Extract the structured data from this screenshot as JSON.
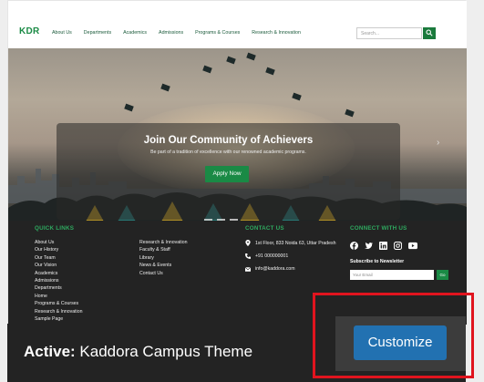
{
  "header": {
    "logo_text": "KDR",
    "nav_items": [
      "About Us",
      "Departments",
      "Academics",
      "Admissions",
      "Programs & Courses",
      "Research & Innovation"
    ],
    "search_placeholder": "Search..."
  },
  "hero": {
    "title": "Join Our Community of Achievers",
    "subtitle": "Be part of a tradition of excellence with our renowned academic programs.",
    "cta_label": "Apply Now"
  },
  "footer": {
    "quick_links_title": "QUICK LINKS",
    "quick_links_col1": [
      "About Us",
      "Our History",
      "Our Team",
      "Our Vision",
      "Academics",
      "Admissions",
      "Departments",
      "Home",
      "Programs & Courses",
      "Research & Innovation",
      "Sample Page"
    ],
    "quick_links_col2": [
      "Research & Innovation",
      "Faculty & Staff",
      "Library",
      "News & Events",
      "Contact Us"
    ],
    "contact_title": "CONTACT US",
    "contact_address": "1st Floor, 833 Noida 63, Uttar Pradesh",
    "contact_phone": "+91 000000001",
    "contact_email": "info@kaddora.com",
    "connect_title": "CONNECT WITH US",
    "social_icons": [
      "facebook-icon",
      "twitter-icon",
      "linkedin-icon",
      "instagram-icon",
      "youtube-icon"
    ],
    "newsletter_title": "Subscribe to Newsletter",
    "email_placeholder": "Your Email",
    "go_label": "Go"
  },
  "theme_bar": {
    "active_prefix": "Active:",
    "theme_name": "Kaddora Campus Theme",
    "customize_label": "Customize"
  },
  "colors": {
    "brand_green": "#1a8a45",
    "footer_bg": "#232323",
    "customize_blue": "#2271b1",
    "highlight_red": "#e0141e"
  }
}
